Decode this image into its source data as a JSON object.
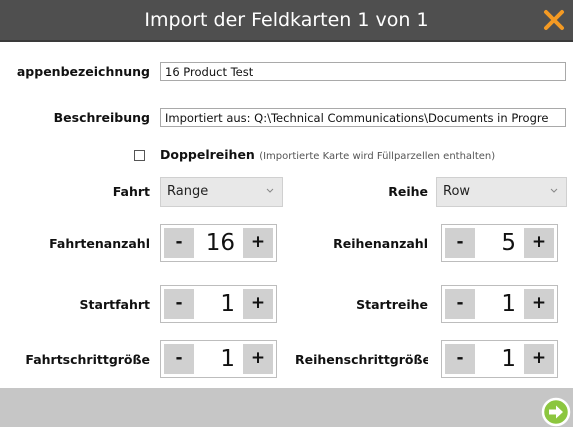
{
  "dialog": {
    "title": "Import der Feldkarten 1 von 1",
    "accent_color": "#f49a23"
  },
  "fields": {
    "name_label": "appenbezeichnung",
    "name_value": "16 Product Test",
    "desc_label": "Beschreibung",
    "desc_value": "Importiert aus: Q:\\Technical Communications\\Documents in Progre",
    "double_rows_checked": false,
    "double_rows_label": "Doppelreihen",
    "double_rows_hint": "(Importierte Karte wird Füllparzellen enthalten)"
  },
  "fahrt": {
    "label": "Fahrt",
    "selected": "Range"
  },
  "reihe": {
    "label": "Reihe",
    "selected": "Row"
  },
  "steppers": {
    "fahrtenanzahl": {
      "label": "Fahrtenanzahl",
      "value": "16"
    },
    "reihenanzahl": {
      "label": "Reihenanzahl",
      "value": "5"
    },
    "startfahrt": {
      "label": "Startfahrt",
      "value": "1"
    },
    "startreihe": {
      "label": "Startreihe",
      "value": "1"
    },
    "fahrtschrittgroesse": {
      "label": "Fahrtschrittgröße",
      "value": "1"
    },
    "reihenschrittgroesse": {
      "label": "Reihenschrittgröße",
      "value": "1"
    },
    "minus": "-",
    "plus": "+"
  },
  "icons": {
    "close": "close-x-icon",
    "next": "arrow-right-circle-icon",
    "select": "chevron-down-icon"
  }
}
